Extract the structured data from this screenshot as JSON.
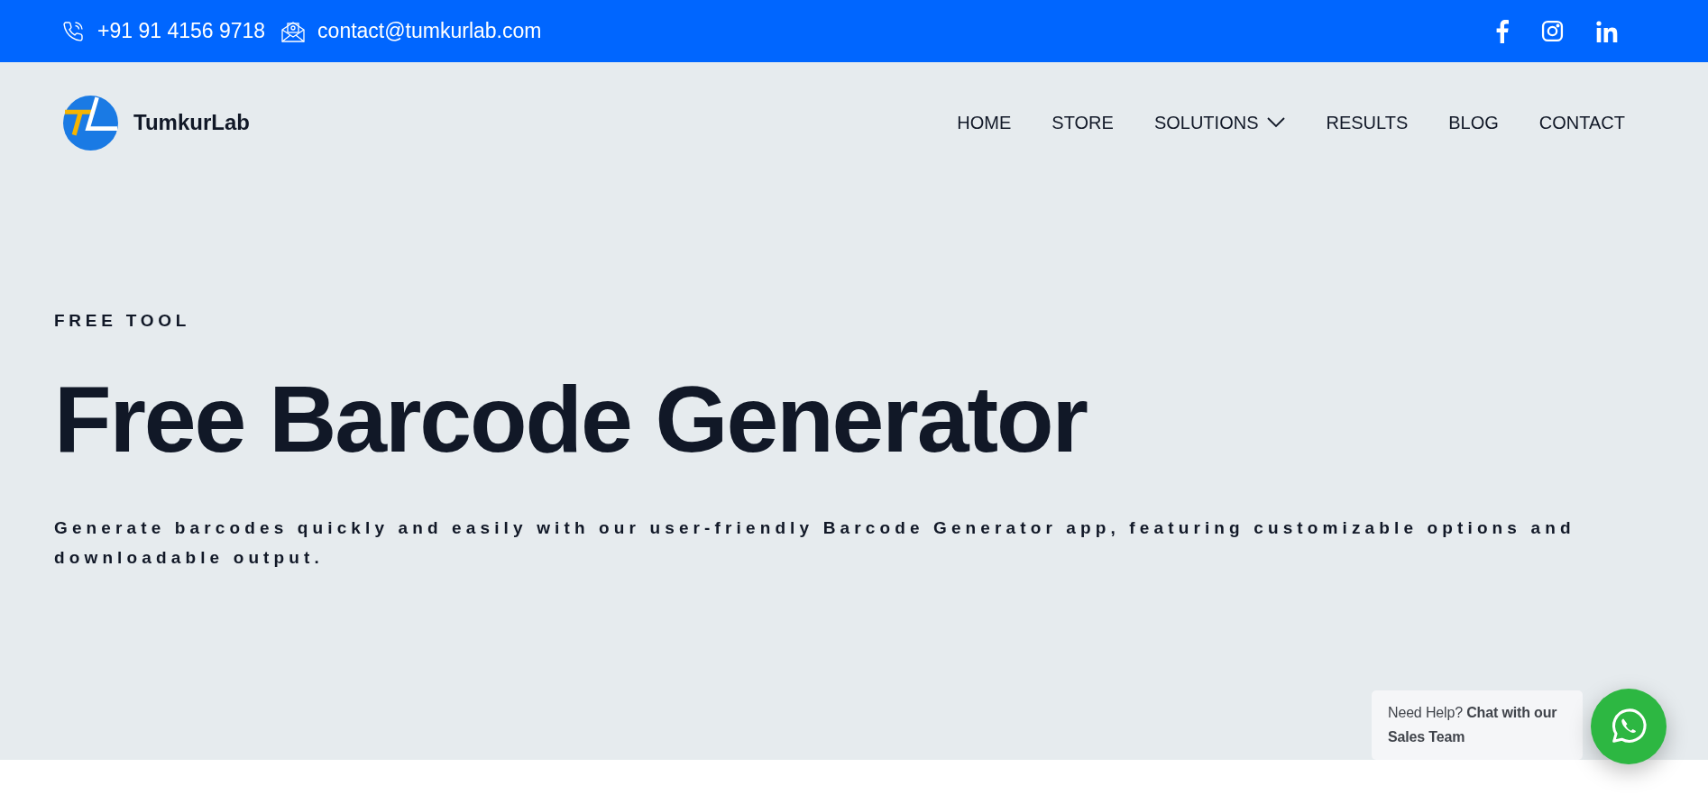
{
  "top_bar": {
    "phone": "+91 91 4156 9718",
    "email": "contact@tumkurlab.com"
  },
  "header": {
    "brand": "TumkurLab",
    "nav": [
      {
        "label": "HOME",
        "has_dropdown": false
      },
      {
        "label": "STORE",
        "has_dropdown": false
      },
      {
        "label": "SOLUTIONS",
        "has_dropdown": true
      },
      {
        "label": "RESULTS",
        "has_dropdown": false
      },
      {
        "label": "BLOG",
        "has_dropdown": false
      },
      {
        "label": "CONTACT",
        "has_dropdown": false
      }
    ]
  },
  "hero": {
    "eyebrow": "FREE TOOL",
    "title": "Free Barcode Generator",
    "subtitle": "Generate barcodes quickly and easily with our user-friendly Barcode Generator app, featuring customizable options and downloadable output."
  },
  "chat_widget": {
    "message": "Need Help? **Chat with our Sales Team**"
  }
}
